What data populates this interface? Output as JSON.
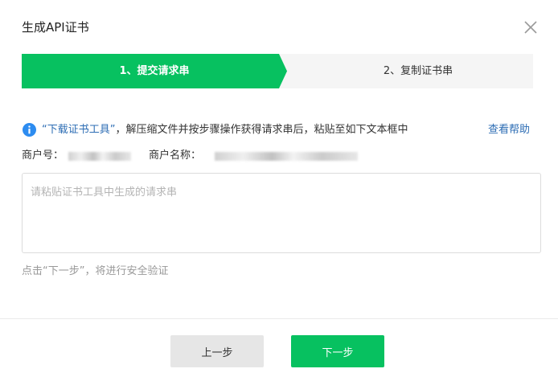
{
  "dialog": {
    "title": "生成API证书"
  },
  "steps": [
    {
      "label": "1、提交请求串",
      "active": true
    },
    {
      "label": "2、复制证书串",
      "active": false
    }
  ],
  "notice": {
    "link_text": "“下载证书工具”",
    "text": "，解压缩文件并按步骤操作获得请求串后，粘贴至如下文本框中",
    "help_link": "查看帮助"
  },
  "merchant": {
    "id_label": "商户号：",
    "name_label": "商户名称："
  },
  "request_input": {
    "placeholder": "请粘贴证书工具中生成的请求串",
    "value": ""
  },
  "hint": "点击“下一步”，将进行安全验证",
  "buttons": {
    "prev": "上一步",
    "next": "下一步"
  },
  "colors": {
    "accent": "#07c160",
    "link": "#2d6db4",
    "info_icon": "#2d8cf0",
    "inactive_step": "#f5f5f5"
  },
  "icons": {
    "close": "close-icon",
    "info": "info-icon"
  }
}
